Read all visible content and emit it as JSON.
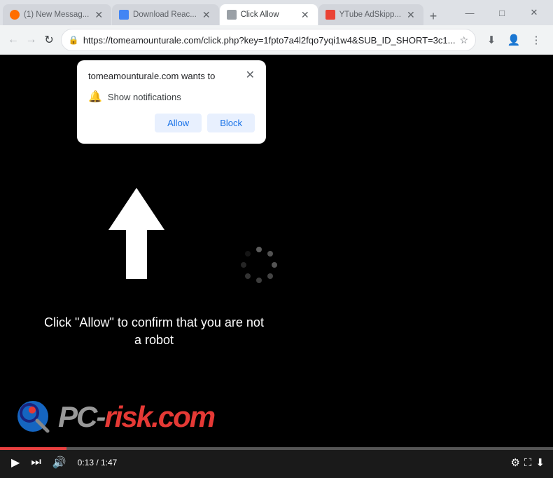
{
  "browser": {
    "tabs": [
      {
        "id": "tab1",
        "label": "(1) New Messag...",
        "favicon_type": "orange",
        "active": false
      },
      {
        "id": "tab2",
        "label": "Download Reac...",
        "favicon_type": "blue",
        "active": false
      },
      {
        "id": "tab3",
        "label": "Click Allow",
        "favicon_type": "grey",
        "active": true
      },
      {
        "id": "tab4",
        "label": "YTube AdSkipp...",
        "favicon_type": "red",
        "active": false
      }
    ],
    "address": "https://tomeamounturale.com/click.php?key=1fpto7a4l2fqo7yqi1w4&SUB_ID_SHORT=3c1...",
    "address_short": "https://tomeamounturale.com/click.php?key=1fpto7a4l2fqo7yqi1w4&SUB_ID_SHORT=3c1...",
    "window_controls": {
      "minimize": "—",
      "maximize": "□",
      "close": "✕"
    }
  },
  "popup": {
    "site_name": "tomeamounturale.com wants to",
    "permission_label": "Show notifications",
    "allow_label": "Allow",
    "block_label": "Block",
    "close_icon": "✕"
  },
  "page": {
    "captcha_text": "Click \"Allow\" to confirm that you are not a robot",
    "logo_text": "risk.com",
    "logo_pc": "PC-"
  },
  "video": {
    "current_time": "0:13",
    "total_time": "1:47",
    "time_display": "0:13 / 1:47"
  },
  "icons": {
    "back": "←",
    "forward": "→",
    "refresh": "↻",
    "lock": "🔒",
    "star": "☆",
    "download": "⬇",
    "account": "👤",
    "menu": "⋮",
    "play": "▶",
    "skip": "⏭",
    "volume": "🔊",
    "settings": "⚙",
    "fullscreen": "⛶",
    "download_video": "⬇"
  }
}
